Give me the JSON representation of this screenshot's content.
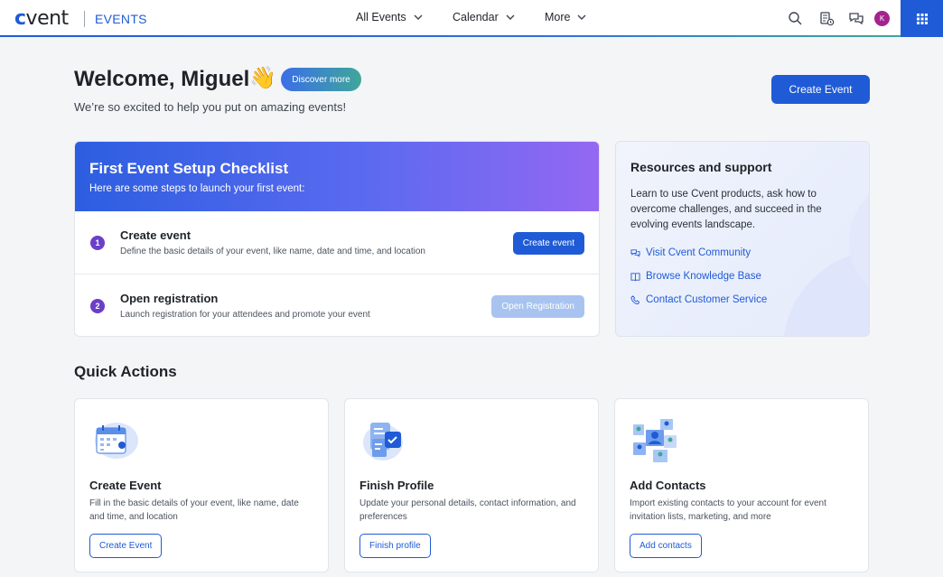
{
  "header": {
    "logo": "cvent",
    "product": "EVENTS",
    "nav": [
      {
        "label": "All Events"
      },
      {
        "label": "Calendar"
      },
      {
        "label": "More"
      }
    ],
    "avatar_initial": "K"
  },
  "welcome": {
    "greeting": "Welcome, Miguel",
    "emoji": "👋",
    "discover_label": "Discover more",
    "subtitle": "We’re so excited to help you put on amazing events!",
    "create_button": "Create Event"
  },
  "checklist": {
    "title": "First Event Setup Checklist",
    "subtitle": "Here are some steps to launch your first event:",
    "steps": [
      {
        "number": "1",
        "title": "Create event",
        "description": "Define the basic details of your event, like name, date and time, and location",
        "button": "Create event"
      },
      {
        "number": "2",
        "title": "Open registration",
        "description": "Launch registration for your attendees and promote your event",
        "button": "Open Registration"
      }
    ]
  },
  "resources": {
    "title": "Resources and support",
    "description": "Learn to use Cvent products, ask how to overcome challenges, and succeed in the evolving events landscape.",
    "links": [
      {
        "label": "Visit Cvent Community",
        "icon": "chat-bubbles-icon"
      },
      {
        "label": "Browse Knowledge Base",
        "icon": "book-icon"
      },
      {
        "label": "Contact Customer Service",
        "icon": "phone-icon"
      }
    ]
  },
  "quick_actions": {
    "title": "Quick Actions",
    "cards": [
      {
        "title": "Create Event",
        "description": "Fill in the basic details of your event, like name, date and time, and location",
        "button": "Create Event",
        "icon": "calendar-illustration"
      },
      {
        "title": "Finish Profile",
        "description": "Update your personal details, contact information, and preferences",
        "button": "Finish profile",
        "icon": "profile-checklist-illustration"
      },
      {
        "title": "Add Contacts",
        "description": "Import existing contacts to your account for event invitation lists, marketing, and more",
        "button": "Add contacts",
        "icon": "contacts-illustration"
      }
    ]
  },
  "colors": {
    "primary": "#1f5bd6",
    "step_badge": "#6b3fc9",
    "avatar": "#a3238e"
  }
}
